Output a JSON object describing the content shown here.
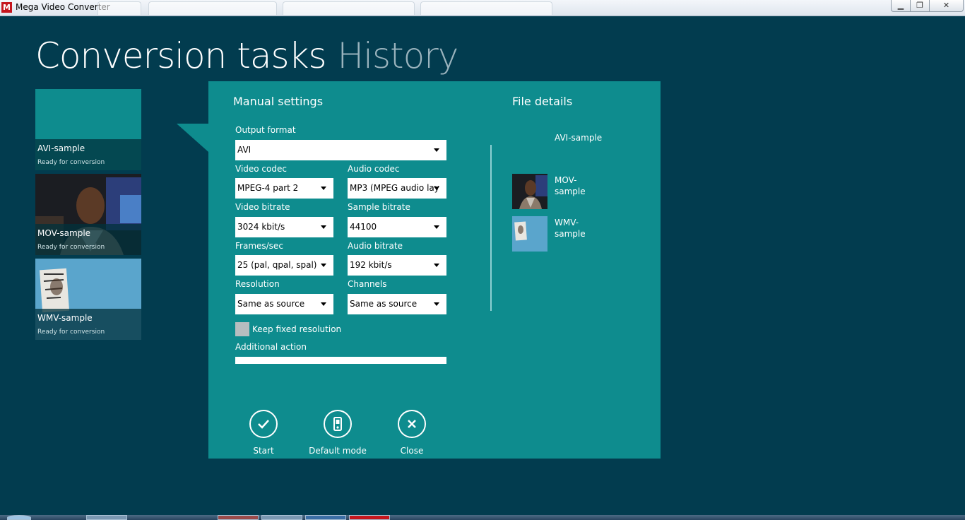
{
  "window": {
    "title": "Mega Video Converter"
  },
  "header": {
    "active_tab": "Conversion tasks",
    "inactive_tab": "History"
  },
  "tasks": [
    {
      "name": "AVI-sample",
      "status": "Ready for conversion"
    },
    {
      "name": "MOV-sample",
      "status": "Ready for conversion"
    },
    {
      "name": "WMV-sample",
      "status": "Ready for conversion"
    }
  ],
  "settings": {
    "title": "Manual settings",
    "output_format": {
      "label": "Output format",
      "value": "AVI"
    },
    "video_codec": {
      "label": "Video codec",
      "value": "MPEG-4 part 2"
    },
    "audio_codec": {
      "label": "Audio codec",
      "value": "MP3 (MPEG audio lay"
    },
    "video_bitrate": {
      "label": "Video bitrate",
      "value": "3024 kbit/s"
    },
    "sample_bitrate": {
      "label": "Sample bitrate",
      "value": "44100"
    },
    "frames": {
      "label": "Frames/sec",
      "value": "25 (pal, qpal, spal)"
    },
    "audio_bitrate": {
      "label": "Audio bitrate",
      "value": "192 kbit/s"
    },
    "resolution": {
      "label": "Resolution",
      "value": "Same as source"
    },
    "channels": {
      "label": "Channels",
      "value": "Same as source"
    },
    "keep_fixed": {
      "label": "Keep fixed resolution"
    },
    "additional_action": {
      "label": "Additional action",
      "value": ""
    }
  },
  "actions": {
    "start": "Start",
    "default_mode": "Default mode",
    "close": "Close"
  },
  "file_details": {
    "title": "File details",
    "files": [
      {
        "name": "AVI-sample"
      },
      {
        "name": "MOV-sample"
      },
      {
        "name": "WMV-sample"
      }
    ]
  },
  "colors": {
    "background": "#023c4f",
    "panel": "#0e8c8e",
    "brand": "#c5161d"
  }
}
